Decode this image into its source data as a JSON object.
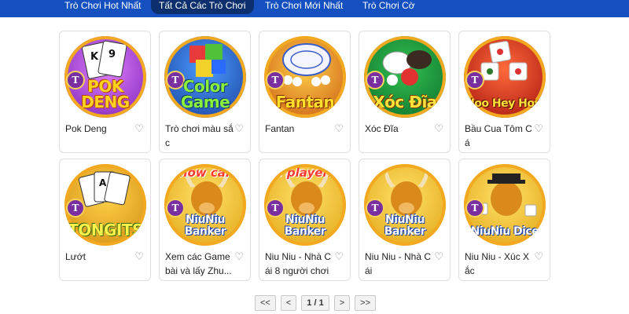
{
  "tabs": [
    {
      "label": "Trò Chơi Hot Nhất"
    },
    {
      "label": "Tất Cả Các Trò Chơi",
      "active": true
    },
    {
      "label": "Trò Chơi Mới Nhất"
    },
    {
      "label": "Trò Chơi Cờ"
    }
  ],
  "games": [
    {
      "title": "Pok Deng",
      "logo": "POK DENG",
      "icon": "playing-cards-icon"
    },
    {
      "title": "Trò chơi màu sắc",
      "logo": "Color Game",
      "icon": "color-cubes-icon"
    },
    {
      "title": "Fantan",
      "logo": "Fantan",
      "icon": "bowl-icon"
    },
    {
      "title": "Xóc Đĩa",
      "logo": "Xóc Đĩa",
      "icon": "coins-bowl-icon"
    },
    {
      "title": "Bầu Cua Tôm Cá",
      "logo": "Hoo Hey How",
      "icon": "dice-icon"
    },
    {
      "title": "Lướt",
      "logo": "TONGITS",
      "icon": "playing-cards-icon"
    },
    {
      "title": "Xem các Game bài và lấy Zhu...",
      "top": "Show card",
      "logo": "NiuNiu Banker",
      "icon": "bull-icon"
    },
    {
      "title": "Niu Niu - Nhà Cái 8 người chơi",
      "top": "8 players",
      "logo": "NiuNiu Banker",
      "icon": "bull-icon"
    },
    {
      "title": "Niu Niu - Nhà Cái",
      "logo": "NiuNiu Banker",
      "icon": "bull-icon"
    },
    {
      "title": "Niu Niu - Xúc Xắc",
      "logo": "NiuNiu Dice",
      "icon": "bull-dice-icon"
    }
  ],
  "badge_letter": "T",
  "pagination": {
    "first": "<<",
    "prev": "<",
    "page": "1 / 1",
    "next": ">",
    "last": ">>"
  },
  "colors": {
    "nav": "#1450c0",
    "nav_active": "#0d2f6e",
    "ring": "#f2a91f",
    "badge": "#7a2fa0"
  }
}
